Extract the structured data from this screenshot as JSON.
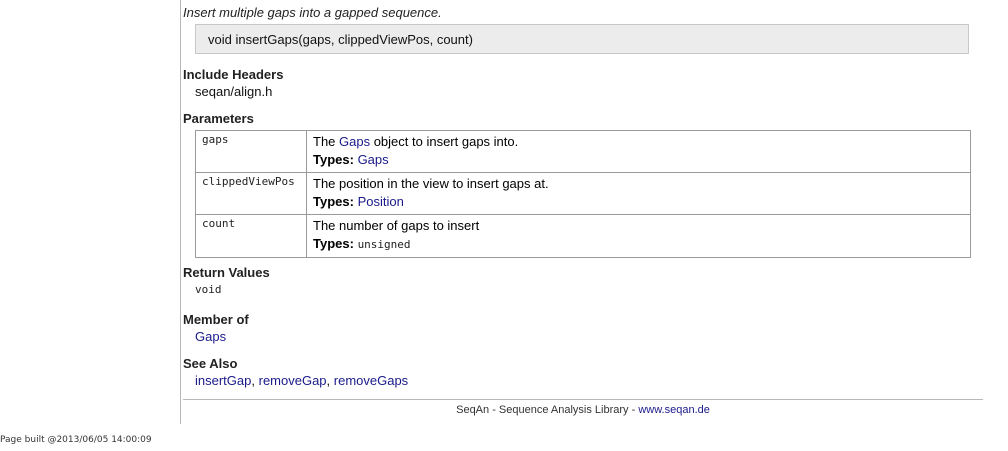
{
  "summary": "Insert multiple gaps into a gapped sequence.",
  "signature": "void insertGaps(gaps, clippedViewPos, count)",
  "include_headers": {
    "heading": "Include Headers",
    "value": "seqan/align.h"
  },
  "parameters": {
    "heading": "Parameters",
    "types_label": "Types:",
    "rows": [
      {
        "name": "gaps",
        "desc_prefix": "The ",
        "desc_link": "Gaps",
        "desc_suffix": " object to insert gaps into.",
        "type": "Gaps"
      },
      {
        "name": "clippedViewPos",
        "desc": "The position in the view to insert gaps at.",
        "type": "Position"
      },
      {
        "name": "count",
        "desc": "The number of gaps to insert",
        "type": "unsigned"
      }
    ]
  },
  "return_values": {
    "heading": "Return Values",
    "value": "void"
  },
  "member_of": {
    "heading": "Member of",
    "link": "Gaps"
  },
  "see_also": {
    "heading": "See Also",
    "links": [
      "insertGap",
      "removeGap",
      "removeGaps"
    ],
    "separator": ", "
  },
  "footer": {
    "text": "SeqAn - Sequence Analysis Library - ",
    "link": "www.seqan.de"
  },
  "build_info": "Page built @2013/06/05 14:00:09"
}
